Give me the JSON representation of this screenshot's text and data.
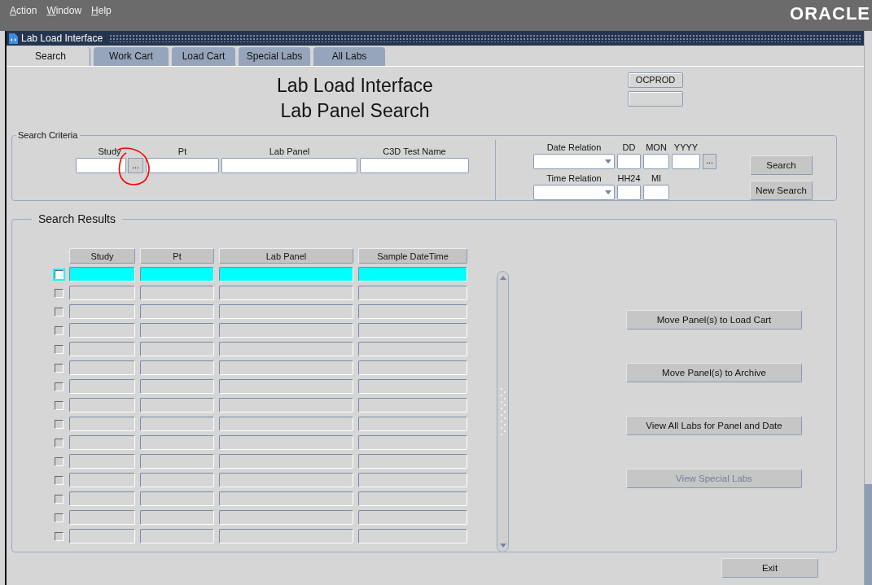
{
  "menu": [
    {
      "label": "Action"
    },
    {
      "label": "Window"
    },
    {
      "label": "Help"
    }
  ],
  "brand": "ORACLE",
  "window": {
    "title": "Lab Load Interface"
  },
  "tabs": [
    {
      "label": "Search",
      "selected": true
    },
    {
      "label": "Work Cart",
      "selected": false
    },
    {
      "label": "Load Cart",
      "selected": false
    },
    {
      "label": "Special Labs",
      "selected": false
    },
    {
      "label": "All Labs",
      "selected": false
    }
  ],
  "heading": {
    "title": "Lab Load Interface",
    "subtitle": "Lab Panel Search"
  },
  "database": "OCPROD",
  "criteria": {
    "legend": "Search Criteria",
    "fields": [
      {
        "label": "Study",
        "kind": "lov"
      },
      {
        "label": "Pt",
        "kind": "text"
      },
      {
        "label": "Lab Panel",
        "kind": "text"
      },
      {
        "label": "C3D Test Name",
        "kind": "text"
      }
    ],
    "date": {
      "label": "Date Relation",
      "parts": [
        "DD",
        "MON",
        "YYYY"
      ],
      "lov": "..."
    },
    "time": {
      "label": "Time Relation",
      "parts": [
        "HH24",
        "MI"
      ]
    },
    "buttons": [
      {
        "label": "Search"
      },
      {
        "label": "New Search"
      }
    ]
  },
  "annotation": {
    "kind": "circle"
  },
  "results": {
    "legend": "Search Results",
    "columns": [
      "Study",
      "Pt",
      "Lab Panel",
      "Sample DateTime"
    ],
    "rows": [
      {
        "selected": true,
        "checked": false
      },
      {
        "selected": false,
        "checked": false
      },
      {
        "selected": false,
        "checked": false
      },
      {
        "selected": false,
        "checked": false
      },
      {
        "selected": false,
        "checked": false
      },
      {
        "selected": false,
        "checked": false
      },
      {
        "selected": false,
        "checked": false
      },
      {
        "selected": false,
        "checked": false
      },
      {
        "selected": false,
        "checked": false
      },
      {
        "selected": false,
        "checked": false
      },
      {
        "selected": false,
        "checked": false
      },
      {
        "selected": false,
        "checked": false
      },
      {
        "selected": false,
        "checked": false
      },
      {
        "selected": false,
        "checked": false
      },
      {
        "selected": false,
        "checked": false
      }
    ],
    "actions": [
      {
        "label": "Move Panel(s) to Load Cart",
        "disabled": false
      },
      {
        "label": "Move Panel(s) to Archive",
        "disabled": false
      },
      {
        "label": "View All Labs for Panel and Date",
        "disabled": false
      },
      {
        "label": "View Special Labs",
        "disabled": true
      }
    ]
  },
  "exit": "Exit"
}
